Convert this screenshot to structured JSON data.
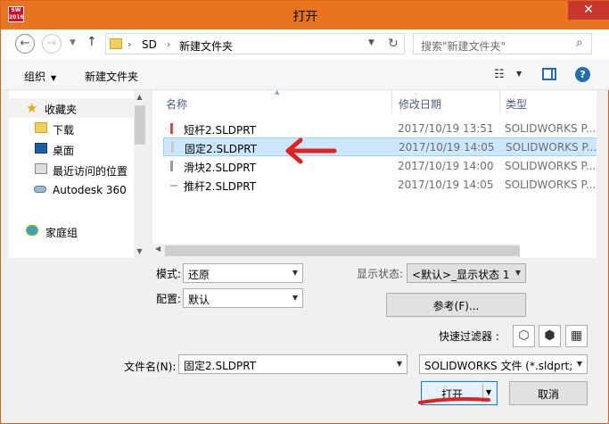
{
  "window": {
    "title": "打开",
    "app_icon_text": "SW 2016",
    "close_glyph": "✕"
  },
  "nav": {
    "back_glyph": "←",
    "forward_glyph": "→",
    "up_glyph": "↑",
    "breadcrumb": [
      "SD",
      "新建文件夹"
    ],
    "search_placeholder": "搜索\"新建文件夹\""
  },
  "toolbar": {
    "organize_label": "组织",
    "new_folder_label": "新建文件夹"
  },
  "sidebar": {
    "items": [
      {
        "label": "收藏夹",
        "icon": "star-icon"
      },
      {
        "label": "下载",
        "icon": "download-folder-icon"
      },
      {
        "label": "桌面",
        "icon": "desktop-icon"
      },
      {
        "label": "最近访问的位置",
        "icon": "recent-places-icon"
      },
      {
        "label": "Autodesk 360",
        "icon": "cloud-icon"
      },
      {
        "label": "家庭组",
        "icon": "homegroup-icon"
      }
    ]
  },
  "filelist": {
    "columns": {
      "name": "名称",
      "date": "修改日期",
      "type": "类型"
    },
    "rows": [
      {
        "name": "短杆2.SLDPRT",
        "date": "2017/10/19 13:51",
        "type": "SOLIDWORKS P..."
      },
      {
        "name": "固定2.SLDPRT",
        "date": "2017/10/19 14:05",
        "type": "SOLIDWORKS P..."
      },
      {
        "name": "滑块2.SLDPRT",
        "date": "2017/10/19 14:00",
        "type": "SOLIDWORKS P..."
      },
      {
        "name": "推杆2.SLDPRT",
        "date": "2017/10/19 14:05",
        "type": "SOLIDWORKS P..."
      }
    ],
    "selected_index": 1
  },
  "options": {
    "mode_label": "模式:",
    "mode_value": "还原",
    "config_label": "配置:",
    "config_value": "默认",
    "display_state_label": "显示状态:",
    "display_state_value": "<默认>_显示状态 1",
    "browse_label": "参考(F)...",
    "quick_filter_label": "快速过滤器 :"
  },
  "bottom": {
    "filename_label": "文件名(N):",
    "filename_value": "固定2.SLDPRT",
    "filetype_value": "SOLIDWORKS 文件 (*.sldprt;",
    "open_label": "打开",
    "cancel_label": "取消"
  },
  "colors": {
    "accent_titlebar": "#e8741f",
    "selection": "#cce8ff",
    "annotation_red": "#e2221d"
  }
}
